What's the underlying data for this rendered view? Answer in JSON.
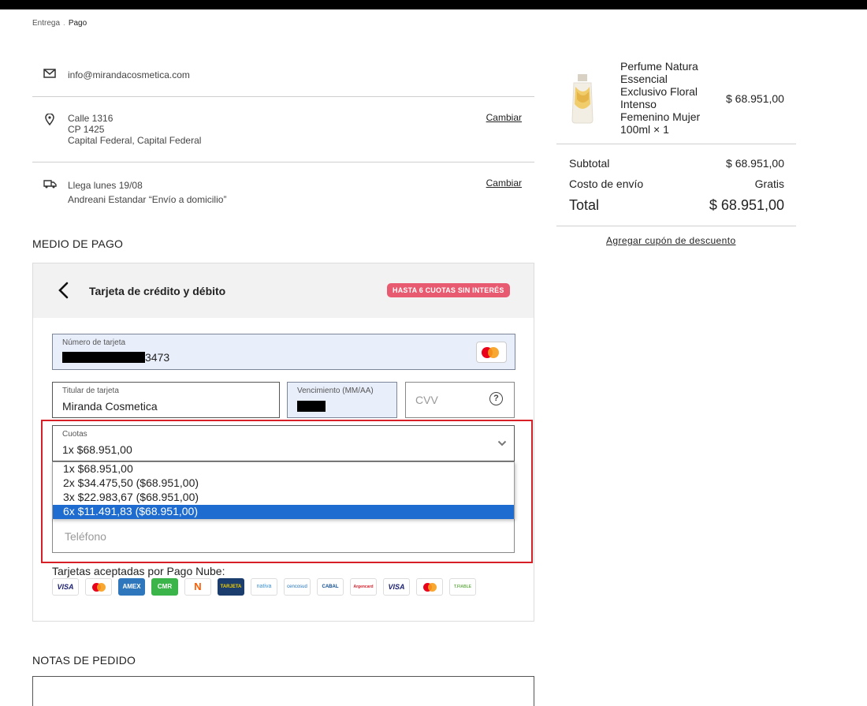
{
  "breadcrumb": {
    "step1": "Entrega",
    "step2": "Pago"
  },
  "email": {
    "value": "info@mirandacosmetica.com"
  },
  "address": {
    "line1": "Calle 1316",
    "line2": "CP 1425",
    "line3": "Capital Federal, Capital Federal",
    "change_label": "Cambiar"
  },
  "shipping": {
    "line1": "Llega lunes 19/08",
    "line2": "Andreani Estandar “Envío a domicilio”",
    "change_label": "Cambiar"
  },
  "payment": {
    "section_title": "MEDIO DE PAGO",
    "method_title": "Tarjeta de crédito y débito",
    "badge": "HASTA 6 CUOTAS SIN INTERÉS",
    "card_number_label": "Número de tarjeta",
    "card_number_suffix": "3473",
    "holder_label": "Titular de tarjeta",
    "holder_value": "Miranda Cosmetica",
    "expiry_label": "Vencimiento (MM/AA)",
    "cvv_placeholder": "CVV",
    "cuotas_label": "Cuotas",
    "cuotas_value": "1x $68.951,00",
    "cuotas_options": [
      "1x $68.951,00",
      "2x $34.475,50 ($68.951,00)",
      "3x $22.983,67 ($68.951,00)",
      "6x $11.491,83 ($68.951,00)"
    ],
    "cuotas_highlighted_index": 3,
    "phone_placeholder": "Teléfono",
    "accepted_title": "Tarjetas aceptadas por Pago Nube:",
    "cards": [
      {
        "name": "visa",
        "label": "VISA",
        "color": "#1a1f71"
      },
      {
        "name": "mastercard",
        "label": "",
        "color": "#eb001b"
      },
      {
        "name": "amex",
        "label": "AMEX",
        "color": "#2e77bc"
      },
      {
        "name": "cmr",
        "label": "CMR",
        "color": "#3bb54a"
      },
      {
        "name": "naranja",
        "label": "N",
        "color": "#ff5a00"
      },
      {
        "name": "shopping",
        "label": "TARJETA",
        "color": "#1a3d6d"
      },
      {
        "name": "nativa",
        "label": "nativa",
        "color": "#3a8fd2"
      },
      {
        "name": "cencosud",
        "label": "cencosud",
        "color": "#1d6fb8"
      },
      {
        "name": "cabal",
        "label": "CABAL",
        "color": "#0b4a8f"
      },
      {
        "name": "argencard",
        "label": "Argencard",
        "color": "#d4202c"
      },
      {
        "name": "visa-debito",
        "label": "VISA",
        "color": "#1a1f71"
      },
      {
        "name": "maestro",
        "label": "",
        "color": "#eb001b"
      },
      {
        "name": "tarjeta-fiable",
        "label": "T.FIABLE",
        "color": "#6ab04c"
      }
    ]
  },
  "notes": {
    "section_title": "NOTAS DE PEDIDO"
  },
  "order": {
    "product_name": "Perfume Natura Essencial Exclusivo Floral Intenso Femenino Mujer 100ml × 1",
    "product_price": "$ 68.951,00",
    "subtotal_label": "Subtotal",
    "subtotal_value": "$ 68.951,00",
    "shipping_label": "Costo de envío",
    "shipping_value": "Gratis",
    "total_label": "Total",
    "total_value": "$ 68.951,00",
    "coupon_label": "Agregar cupón de descuento"
  }
}
